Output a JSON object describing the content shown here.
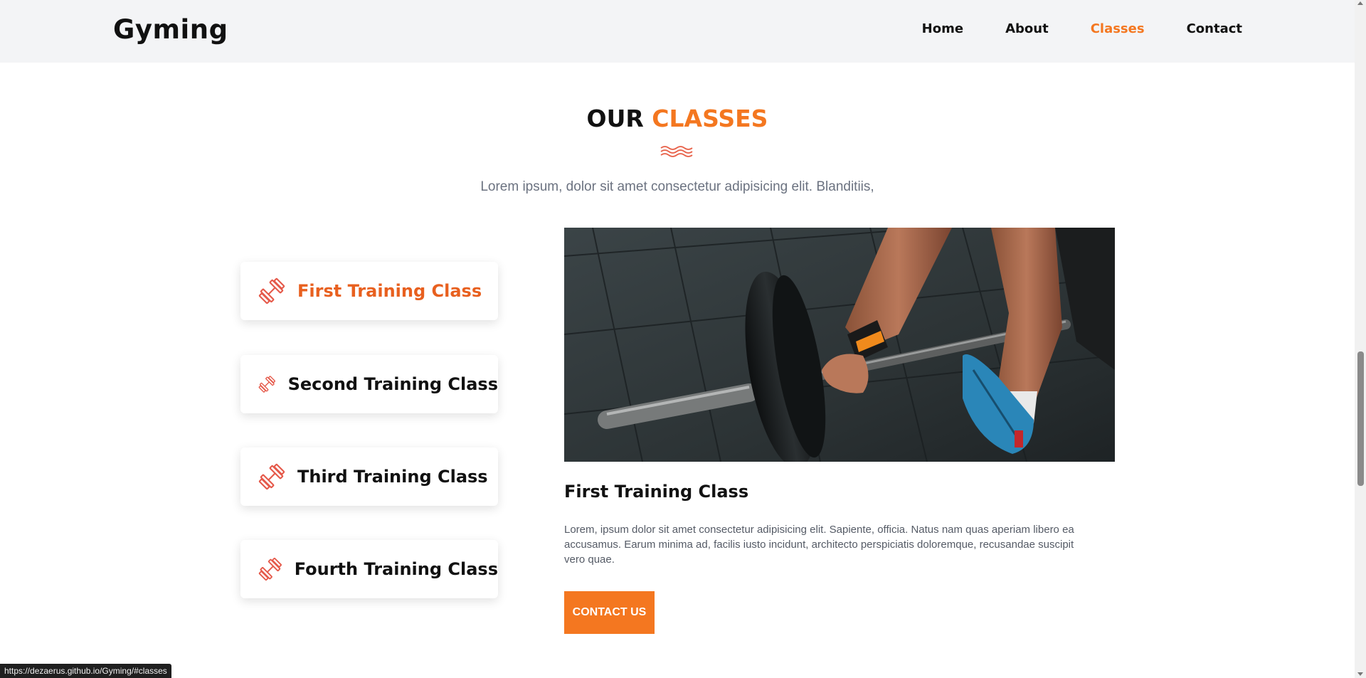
{
  "header": {
    "logo": "Gyming",
    "nav": [
      {
        "label": "Home",
        "active": false
      },
      {
        "label": "About",
        "active": false
      },
      {
        "label": "Classes",
        "active": true
      },
      {
        "label": "Contact",
        "active": false
      }
    ]
  },
  "section": {
    "title_part1": "OUR",
    "title_part2": "CLASSES",
    "subtitle": "Lorem ipsum, dolor sit amet consectetur adipisicing elit. Blanditiis,"
  },
  "classes": [
    {
      "label": "First Training Class",
      "active": true,
      "icon": "dumbbell-icon"
    },
    {
      "label": "Second Training Class",
      "active": false,
      "icon": "dumbbell-icon"
    },
    {
      "label": "Third Training Class",
      "active": false,
      "icon": "dumbbell-icon"
    },
    {
      "label": "Fourth Training Class",
      "active": false,
      "icon": "dumbbell-icon"
    }
  ],
  "detail": {
    "title": "First Training Class",
    "text": "Lorem, ipsum dolor sit amet consectetur adipisicing elit. Sapiente, officia. Natus nam quas aperiam libero ea accusamus. Earum minima ad, facilis iusto incidunt, architecto perspiciatis doloremque, recusandae suscipit vero quae.",
    "button": "CONTACT US"
  },
  "status_url": "https://dezaerus.github.io/Gyming/#classes",
  "colors": {
    "accent": "#f47720",
    "active_card_text": "#e8601f",
    "header_bg": "#f3f4f6"
  }
}
